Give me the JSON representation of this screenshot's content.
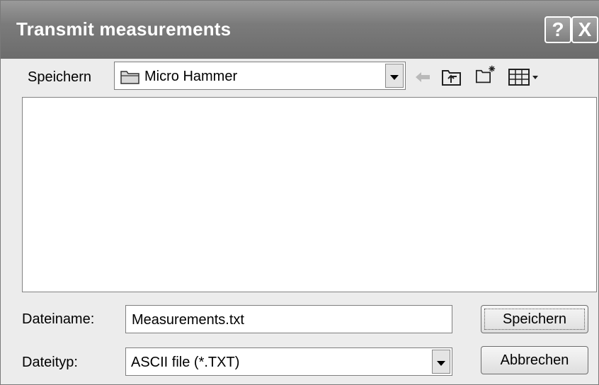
{
  "window": {
    "title": "Transmit measurements",
    "help_label": "?",
    "close_label": "X"
  },
  "save_in": {
    "label": "Speichern",
    "folder": "Micro Hammer"
  },
  "toolbar": {
    "icons": [
      "back-arrow-icon",
      "up-folder-icon",
      "new-folder-icon",
      "view-menu-icon"
    ]
  },
  "filename": {
    "label": "Dateiname:",
    "value": "Measurements.txt"
  },
  "filetype": {
    "label": "Dateityp:",
    "value": "ASCII file (*.TXT)"
  },
  "buttons": {
    "save": "Speichern",
    "cancel": "Abbrechen"
  }
}
